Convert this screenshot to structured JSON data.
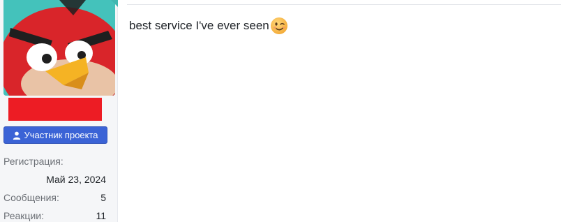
{
  "user": {
    "role_badge": "Участник проекта",
    "avatar_icon": "angry-bird-avatar",
    "stats": [
      {
        "label": "Регистрация:",
        "value": ""
      },
      {
        "label": "",
        "value": "Май 23, 2024"
      },
      {
        "label": "Сообщения:",
        "value": "5"
      },
      {
        "label": "Реакции:",
        "value": "11"
      }
    ],
    "username_color": "#ed1c24",
    "badge_color": "#3b63d6"
  },
  "post": {
    "text": "best service I've ever seen",
    "emoji_icon": "winking-face-emoji"
  }
}
